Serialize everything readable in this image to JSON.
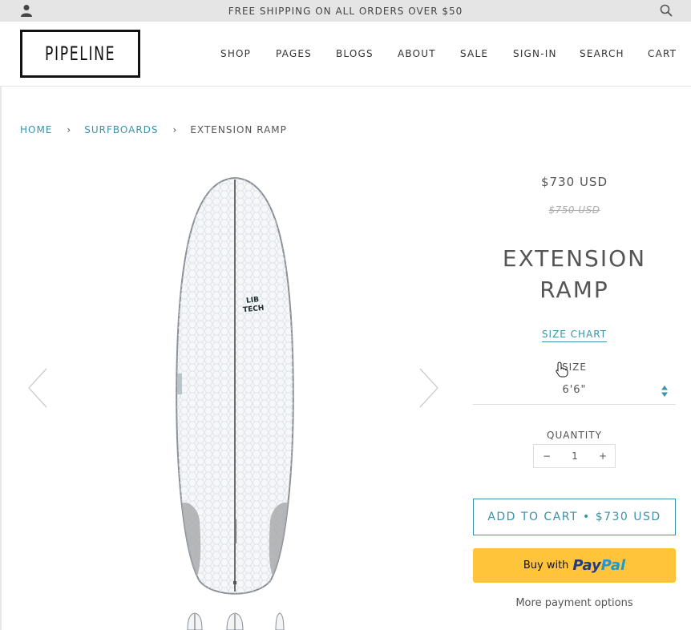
{
  "announcement": {
    "text": "FREE SHIPPING ON ALL ORDERS OVER $50"
  },
  "icons": {
    "account": "user-icon",
    "search": "search-icon",
    "prev": "chevron-left-icon",
    "next": "chevron-right-icon",
    "select": "updown-caret-icon",
    "cursor": "hand-pointer-icon"
  },
  "brand": {
    "logo_text": "PIPELINE"
  },
  "nav": {
    "items": [
      {
        "label": "SHOP"
      },
      {
        "label": "PAGES"
      },
      {
        "label": "BLOGS"
      },
      {
        "label": "ABOUT"
      },
      {
        "label": "SALE"
      },
      {
        "label": "SIGN-IN"
      },
      {
        "label": "SEARCH"
      },
      {
        "label": "CART"
      }
    ]
  },
  "breadcrumb": {
    "home": "HOME",
    "separator": "›",
    "category": "SURFBOARDS",
    "current": "EXTENSION RAMP"
  },
  "product": {
    "price": "$730 USD",
    "compare_price": "$750 USD",
    "title_line1": "EXTENSION",
    "title_line2": "RAMP",
    "board_brand": "LIB TECH",
    "size_chart_label": "SIZE CHART",
    "size_label": "SIZE",
    "size_value": "6'6\"",
    "quantity_label": "QUANTITY",
    "quantity_minus": "−",
    "quantity_value": "1",
    "quantity_plus": "+",
    "add_to_cart": "ADD TO CART • $730 USD",
    "paypal_prefix": "Buy with",
    "paypal_brand_pay": "Pay",
    "paypal_brand_pal": "Pal",
    "more_payment": "More payment options"
  },
  "colors": {
    "accent": "#3a93a8",
    "paypal_yellow": "#ffc439",
    "topbar_bg": "#e5e5e5"
  }
}
